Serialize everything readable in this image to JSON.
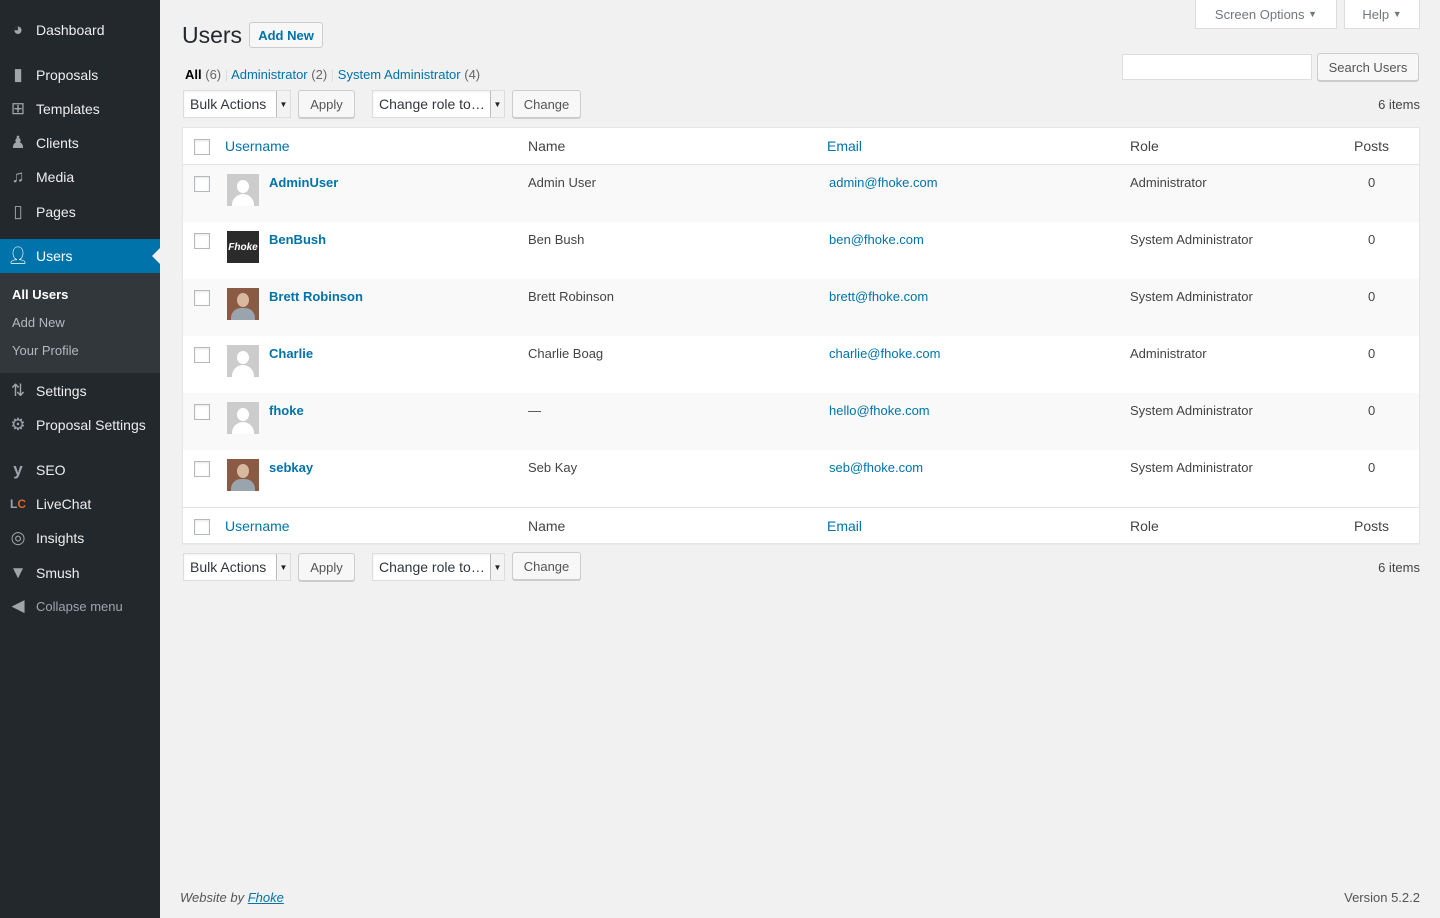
{
  "sidebar": {
    "items": [
      {
        "label": "Dashboard",
        "icon": "dashboard-icon"
      },
      {
        "label": "Proposals",
        "icon": "book-icon"
      },
      {
        "label": "Templates",
        "icon": "grid-icon"
      },
      {
        "label": "Clients",
        "icon": "person-icon"
      },
      {
        "label": "Media",
        "icon": "media-icon"
      },
      {
        "label": "Pages",
        "icon": "pages-icon"
      },
      {
        "label": "Users",
        "icon": "users-icon"
      },
      {
        "label": "Settings",
        "icon": "settings-sliders-icon"
      },
      {
        "label": "Proposal Settings",
        "icon": "gear-icon"
      },
      {
        "label": "SEO",
        "icon": "yoast-icon"
      },
      {
        "label": "LiveChat",
        "icon": "livechat-icon"
      },
      {
        "label": "Insights",
        "icon": "insights-icon"
      },
      {
        "label": "Smush",
        "icon": "smush-icon"
      }
    ],
    "submenu": [
      "All Users",
      "Add New",
      "Your Profile"
    ],
    "collapse": "Collapse menu",
    "active_color": "#0073aa"
  },
  "header": {
    "screen_options": "Screen Options",
    "help": "Help",
    "title": "Users",
    "add_new": "Add New"
  },
  "filters": {
    "all": "All",
    "all_count": "(6)",
    "admin": "Administrator",
    "admin_count": "(2)",
    "sysadmin": "System Administrator",
    "sysadmin_count": "(4)"
  },
  "search": {
    "value": "",
    "button": "Search Users"
  },
  "toolbar": {
    "bulk": "Bulk Actions",
    "apply": "Apply",
    "role": "Change role to…",
    "change": "Change",
    "count": "6 items"
  },
  "columns": {
    "username": "Username",
    "name": "Name",
    "email": "Email",
    "role": "Role",
    "posts": "Posts"
  },
  "users": [
    {
      "username": "AdminUser",
      "name": "Admin User",
      "email": "admin@fhoke.com",
      "role": "Administrator",
      "posts": "0",
      "avatar": "default"
    },
    {
      "username": "BenBush",
      "name": "Ben Bush",
      "email": "ben@fhoke.com",
      "role": "System Administrator",
      "posts": "0",
      "avatar": "fhoke-logo",
      "avatar_text": "Fhoke"
    },
    {
      "username": "Brett Robinson",
      "name": "Brett Robinson",
      "email": "brett@fhoke.com",
      "role": "System Administrator",
      "posts": "0",
      "avatar": "photo"
    },
    {
      "username": "Charlie",
      "name": "Charlie Boag",
      "email": "charlie@fhoke.com",
      "role": "Administrator",
      "posts": "0",
      "avatar": "default"
    },
    {
      "username": "fhoke",
      "name": "—",
      "email": "hello@fhoke.com",
      "role": "System Administrator",
      "posts": "0",
      "avatar": "default"
    },
    {
      "username": "sebkay",
      "name": "Seb Kay",
      "email": "seb@fhoke.com",
      "role": "System Administrator",
      "posts": "0",
      "avatar": "photo"
    }
  ],
  "footer": {
    "credit_prefix": "Website by",
    "credit_link": "Fhoke",
    "version": "Version 5.2.2"
  }
}
